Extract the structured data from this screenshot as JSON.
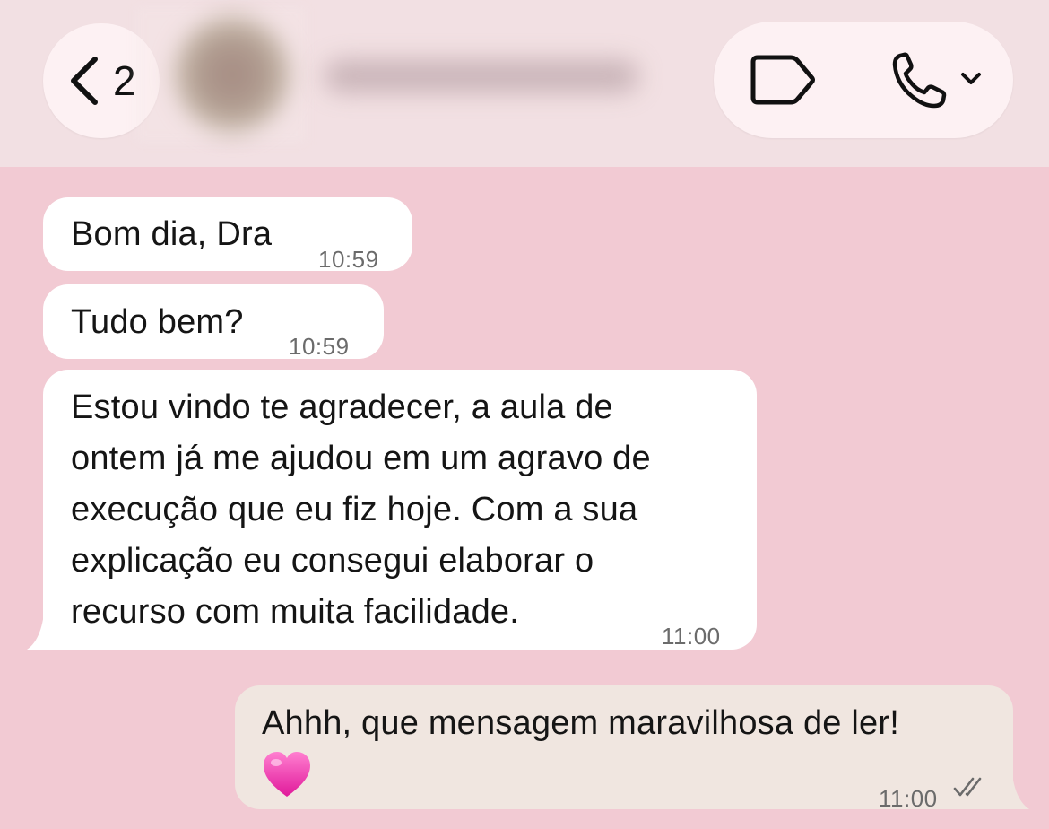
{
  "header": {
    "back_count": "2",
    "contact_name": "",
    "colors": {
      "header_bg": "#f2e0e3",
      "pill_bg": "#fdf1f3"
    },
    "icons": [
      "chevron-left-icon",
      "label-tag-icon",
      "phone-icon",
      "chevron-down-icon"
    ]
  },
  "chat": {
    "background": "#f2cad3",
    "messages": [
      {
        "direction": "incoming",
        "text": "Bom dia, Dra",
        "time": "10:59"
      },
      {
        "direction": "incoming",
        "text": "Tudo bem?",
        "time": "10:59"
      },
      {
        "direction": "incoming",
        "lines": [
          "Estou vindo te agradecer, a aula de",
          "ontem já me ajudou em um agravo de",
          "execução que eu fiz hoje. Com a sua",
          "explicação eu consegui elaborar o",
          "recurso com muita facilidade."
        ],
        "time": "11:00"
      },
      {
        "direction": "outgoing",
        "text": "Ahhh, que mensagem maravilhosa de ler!",
        "emoji": "pink-heart",
        "time": "11:00",
        "status": "read-double-check"
      }
    ]
  }
}
